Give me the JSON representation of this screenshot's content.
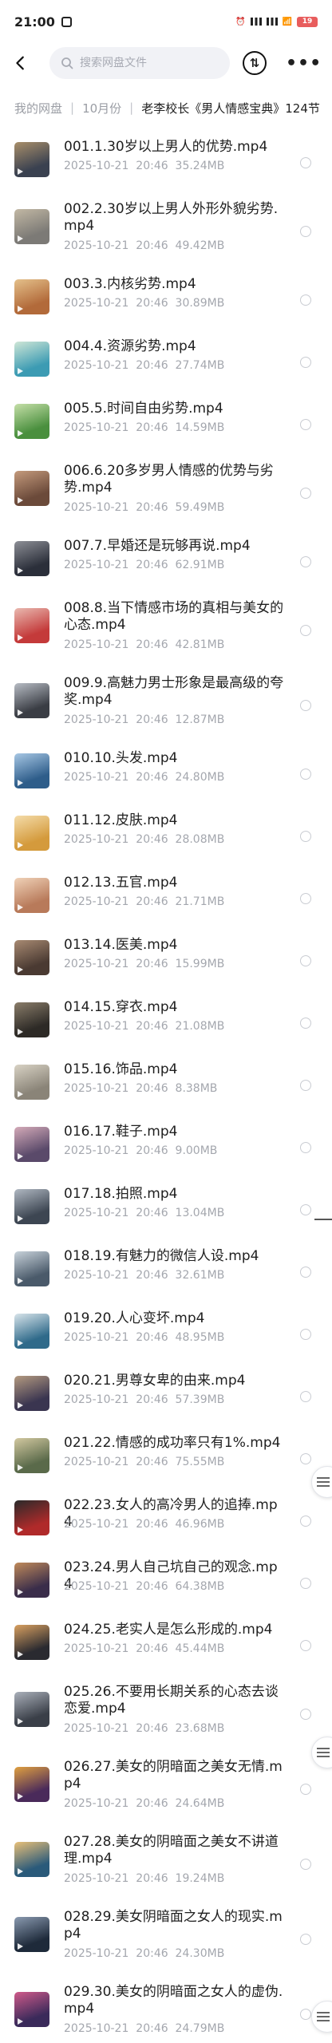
{
  "status_bar": {
    "time": "21:00",
    "battery": "19"
  },
  "search": {
    "placeholder": "搜索网盘文件"
  },
  "breadcrumb": {
    "root": "我的网盘",
    "month": "10月份",
    "current": "老李校长《男人情感宝典》124节"
  },
  "files": [
    {
      "name": "001.1.30岁以上男人的优势.mp4",
      "date": "2025-10-21",
      "time": "20:46",
      "size": "35.24MB",
      "thumb_colors": [
        "#3a4150",
        "#a98f6a"
      ]
    },
    {
      "name": "002.2.30岁以上男人外形外貌劣势.mp4",
      "date": "2025-10-21",
      "time": "20:46",
      "size": "49.42MB",
      "thumb_colors": [
        "#7c7a76",
        "#c2b8a4"
      ]
    },
    {
      "name": "003.3.内核劣势.mp4",
      "date": "2025-10-21",
      "time": "20:46",
      "size": "30.89MB",
      "thumb_colors": [
        "#b26a3a",
        "#e4c08a"
      ]
    },
    {
      "name": "004.4.资源劣势.mp4",
      "date": "2025-10-21",
      "time": "20:46",
      "size": "27.74MB",
      "thumb_colors": [
        "#3c9bb3",
        "#cfe6d6"
      ]
    },
    {
      "name": "005.5.时间自由劣势.mp4",
      "date": "2025-10-21",
      "time": "20:46",
      "size": "14.59MB",
      "thumb_colors": [
        "#4a8f3e",
        "#c5dfa8"
      ]
    },
    {
      "name": "006.6.20多岁男人情感的优势与劣势.mp4",
      "date": "2025-10-21",
      "time": "20:46",
      "size": "59.49MB",
      "thumb_colors": [
        "#6b4a3a",
        "#c49a7c"
      ]
    },
    {
      "name": "007.7.早婚还是玩够再说.mp4",
      "date": "2025-10-21",
      "time": "20:46",
      "size": "62.91MB",
      "thumb_colors": [
        "#2b2f3a",
        "#8d8f96"
      ]
    },
    {
      "name": "008.8.当下情感市场的真相与美女的心态.mp4",
      "date": "2025-10-21",
      "time": "20:46",
      "size": "42.81MB",
      "thumb_colors": [
        "#c43a3a",
        "#e9b9b0"
      ]
    },
    {
      "name": "009.9.高魅力男士形象是最高级的夸奖.mp4",
      "date": "2025-10-21",
      "time": "20:46",
      "size": "12.87MB",
      "thumb_colors": [
        "#3a3d44",
        "#b7bcc4"
      ]
    },
    {
      "name": "010.10.头发.mp4",
      "date": "2025-10-21",
      "time": "20:46",
      "size": "24.80MB",
      "thumb_colors": [
        "#2e5d8a",
        "#a7c7e4"
      ]
    },
    {
      "name": "011.12.皮肤.mp4",
      "date": "2025-10-21",
      "time": "20:46",
      "size": "28.08MB",
      "thumb_colors": [
        "#d49a3c",
        "#f4dcaa"
      ]
    },
    {
      "name": "012.13.五官.mp4",
      "date": "2025-10-21",
      "time": "20:46",
      "size": "21.71MB",
      "thumb_colors": [
        "#b87a5a",
        "#f0d2b8"
      ]
    },
    {
      "name": "013.14.医美.mp4",
      "date": "2025-10-21",
      "time": "20:46",
      "size": "15.99MB",
      "thumb_colors": [
        "#4a3a32",
        "#a88a72"
      ]
    },
    {
      "name": "014.15.穿衣.mp4",
      "date": "2025-10-21",
      "time": "20:46",
      "size": "21.08MB",
      "thumb_colors": [
        "#2d2a26",
        "#8a7d6a"
      ]
    },
    {
      "name": "015.16.饰品.mp4",
      "date": "2025-10-21",
      "time": "20:46",
      "size": "8.38MB",
      "thumb_colors": [
        "#8a8478",
        "#d8d2c4"
      ]
    },
    {
      "name": "016.17.鞋子.mp4",
      "date": "2025-10-21",
      "time": "20:46",
      "size": "9.00MB",
      "thumb_colors": [
        "#5a4a6a",
        "#d4aab8"
      ]
    },
    {
      "name": "017.18.拍照.mp4",
      "date": "2025-10-21",
      "time": "20:46",
      "size": "13.04MB",
      "thumb_colors": [
        "#3d4652",
        "#b0b8c2"
      ]
    },
    {
      "name": "018.19.有魅力的微信人设.mp4",
      "date": "2025-10-21",
      "time": "20:46",
      "size": "32.61MB",
      "thumb_colors": [
        "#4a5a6a",
        "#c8d2da"
      ]
    },
    {
      "name": "019.20.人心变坏.mp4",
      "date": "2025-10-21",
      "time": "20:46",
      "size": "48.95MB",
      "thumb_colors": [
        "#2f6a8a",
        "#d8e4ea"
      ]
    },
    {
      "name": "020.21.男尊女卑的由来.mp4",
      "date": "2025-10-21",
      "time": "20:46",
      "size": "57.39MB",
      "thumb_colors": [
        "#3a3550",
        "#b49a80"
      ]
    },
    {
      "name": "021.22.情感的成功率只有1%.mp4",
      "date": "2025-10-21",
      "time": "20:46",
      "size": "75.55MB",
      "thumb_colors": [
        "#5a6a4a",
        "#d2c8a0"
      ]
    },
    {
      "name": "022.23.女人的高冷男人的追捧.mp4",
      "date": "2025-10-21",
      "time": "20:46",
      "size": "46.96MB",
      "thumb_colors": [
        "#b02a2a",
        "#2a2a2a"
      ]
    },
    {
      "name": "023.24.男人自己坑自己的观念.mp4",
      "date": "2025-10-21",
      "time": "20:46",
      "size": "64.38MB",
      "thumb_colors": [
        "#3a2d4a",
        "#c08a5a"
      ]
    },
    {
      "name": "024.25.老实人是怎么形成的.mp4",
      "date": "2025-10-21",
      "time": "20:46",
      "size": "45.44MB",
      "thumb_colors": [
        "#2a2a30",
        "#d8a060"
      ]
    },
    {
      "name": "025.26.不要用长期关系的心态去谈恋爱.mp4",
      "date": "2025-10-21",
      "time": "20:46",
      "size": "23.68MB",
      "thumb_colors": [
        "#3a3f48",
        "#aab0ba"
      ]
    },
    {
      "name": "026.27.美女的阴暗面之美女无情.mp4",
      "date": "2025-10-21",
      "time": "20:46",
      "size": "24.64MB",
      "thumb_colors": [
        "#4a2a5a",
        "#e0a040"
      ]
    },
    {
      "name": "027.28.美女的阴暗面之美女不讲道理.mp4",
      "date": "2025-10-21",
      "time": "20:46",
      "size": "19.24MB",
      "thumb_colors": [
        "#2a5a7a",
        "#e8c078"
      ]
    },
    {
      "name": "028.29.美女阴暗面之女人的现实.mp4",
      "date": "2025-10-21",
      "time": "20:46",
      "size": "24.30MB",
      "thumb_colors": [
        "#1e2a3a",
        "#8a9ab0"
      ]
    },
    {
      "name": "029.30.美女的阴暗面之女人的虚伪.mp4",
      "date": "2025-10-21",
      "time": "20:46",
      "size": "24.79MB",
      "thumb_colors": [
        "#3a2a5a",
        "#d05a8a"
      ]
    }
  ]
}
